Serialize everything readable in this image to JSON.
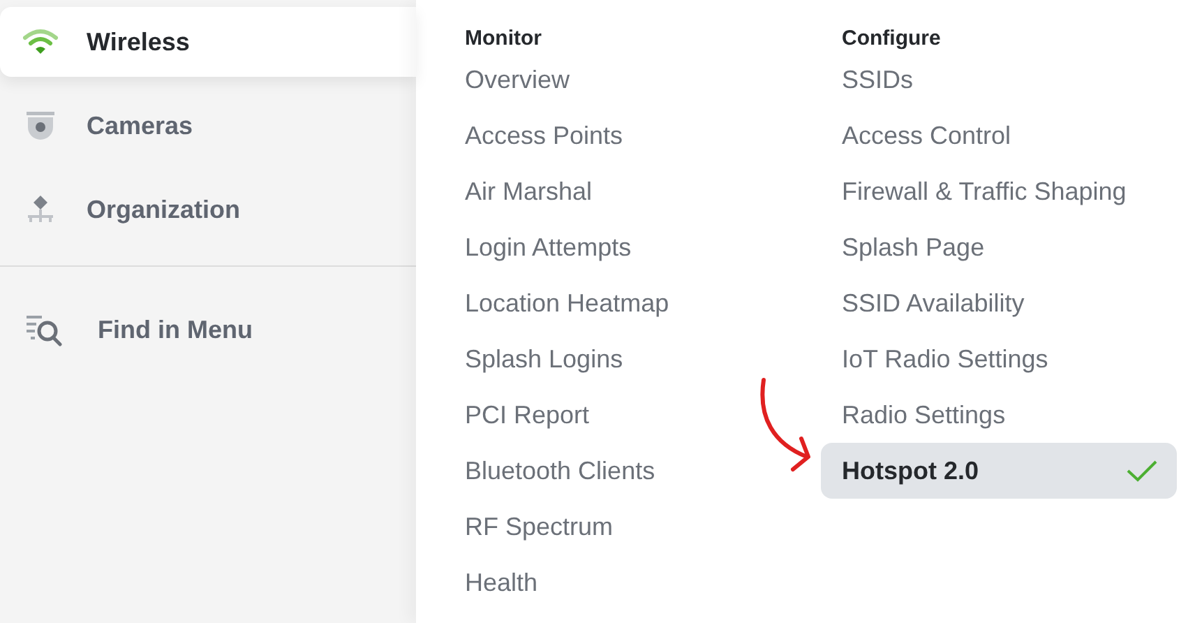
{
  "sidebar": {
    "items": [
      {
        "label": "Wireless",
        "selected": true
      },
      {
        "label": "Cameras",
        "selected": false
      },
      {
        "label": "Organization",
        "selected": false
      }
    ],
    "find": {
      "label": "Find in Menu"
    }
  },
  "menu": {
    "columns": [
      {
        "heading": "Monitor",
        "items": [
          {
            "label": "Overview",
            "selected": false
          },
          {
            "label": "Access Points",
            "selected": false
          },
          {
            "label": "Air Marshal",
            "selected": false
          },
          {
            "label": "Login Attempts",
            "selected": false
          },
          {
            "label": "Location Heatmap",
            "selected": false
          },
          {
            "label": "Splash Logins",
            "selected": false
          },
          {
            "label": "PCI Report",
            "selected": false
          },
          {
            "label": "Bluetooth Clients",
            "selected": false
          },
          {
            "label": "RF Spectrum",
            "selected": false
          },
          {
            "label": "Health",
            "selected": false
          }
        ]
      },
      {
        "heading": "Configure",
        "items": [
          {
            "label": "SSIDs",
            "selected": false
          },
          {
            "label": "Access Control",
            "selected": false
          },
          {
            "label": "Firewall & Traffic Shaping",
            "selected": false
          },
          {
            "label": "Splash Page",
            "selected": false
          },
          {
            "label": "SSID Availability",
            "selected": false
          },
          {
            "label": "IoT Radio Settings",
            "selected": false
          },
          {
            "label": "Radio Settings",
            "selected": false
          },
          {
            "label": "Hotspot 2.0",
            "selected": true
          }
        ]
      }
    ]
  }
}
